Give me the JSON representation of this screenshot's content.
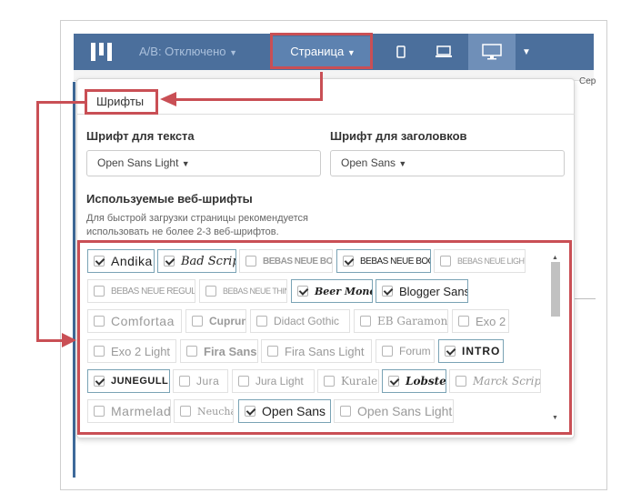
{
  "topbar": {
    "ab_label": "А/В: Отключено",
    "page_label": "Страница",
    "colors": {
      "bar": "#4b6f9c",
      "active": "#5d82b0",
      "highlight": "#c94f55"
    }
  },
  "side": {
    "right_text": "Сер"
  },
  "panel": {
    "tab_label": "Шрифты",
    "text_font_label": "Шрифт для текста",
    "text_font_value": "Open Sans Light",
    "heading_font_label": "Шрифт для заголовков",
    "heading_font_value": "Open Sans",
    "webfonts_title": "Используемые веб-шрифты",
    "webfonts_hint": "Для быстрой загрузки страницы рекомендуется использовать не более 2-3 веб-шрифтов."
  },
  "fonts": [
    {
      "label": "Andika",
      "checked": true
    },
    {
      "label": "Bad Script",
      "checked": true
    },
    {
      "label": "BEBAS NEUE BOLD",
      "checked": false
    },
    {
      "label": "BEBAS NEUE BOOK",
      "checked": true
    },
    {
      "label": "BEBAS NEUE LIGHT",
      "checked": false
    },
    {
      "label": "BEBAS NEUE REGULAR",
      "checked": false
    },
    {
      "label": "BEBAS NEUE THIN",
      "checked": false
    },
    {
      "label": "Beer Money",
      "checked": true
    },
    {
      "label": "Blogger Sans",
      "checked": true
    },
    {
      "label": "Comfortaa",
      "checked": false
    },
    {
      "label": "Cuprum",
      "checked": false
    },
    {
      "label": "Didact Gothic",
      "checked": false
    },
    {
      "label": "EB Garamond",
      "checked": false
    },
    {
      "label": "Exo 2",
      "checked": false
    },
    {
      "label": "Exo 2 Light",
      "checked": false
    },
    {
      "label": "Fira Sans",
      "checked": false
    },
    {
      "label": "Fira Sans Light",
      "checked": false
    },
    {
      "label": "Forum",
      "checked": false
    },
    {
      "label": "INTRO",
      "checked": true
    },
    {
      "label": "JUNEGULL",
      "checked": true
    },
    {
      "label": "Jura",
      "checked": false
    },
    {
      "label": "Jura Light",
      "checked": false
    },
    {
      "label": "Kurale",
      "checked": false
    },
    {
      "label": "Lobster",
      "checked": true
    },
    {
      "label": "Marck Script",
      "checked": false
    },
    {
      "label": "Marmelad",
      "checked": false
    },
    {
      "label": "Neucha",
      "checked": false
    },
    {
      "label": "Open Sans",
      "checked": true
    },
    {
      "label": "Open Sans Light",
      "checked": false
    }
  ]
}
